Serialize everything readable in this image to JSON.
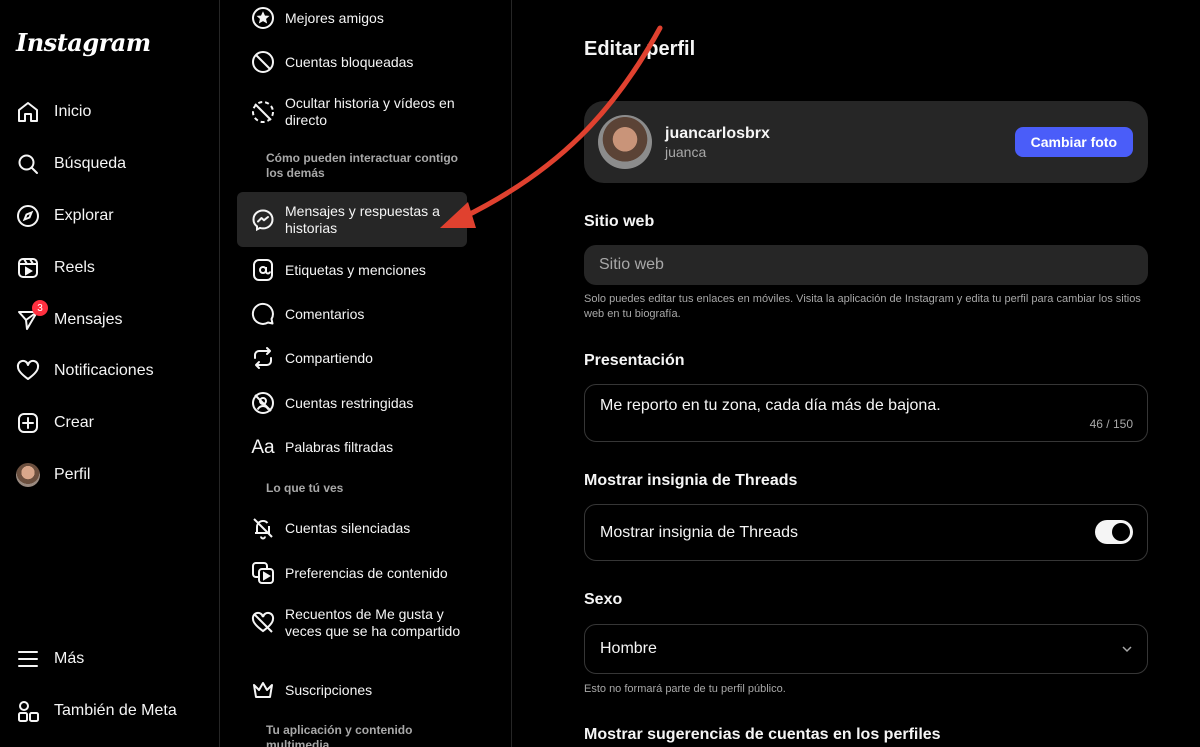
{
  "app": {
    "logo": "Instagram"
  },
  "nav": {
    "items": [
      {
        "label": "Inicio",
        "icon": "home-icon"
      },
      {
        "label": "Búsqueda",
        "icon": "search-icon"
      },
      {
        "label": "Explorar",
        "icon": "compass-icon"
      },
      {
        "label": "Reels",
        "icon": "reels-icon"
      },
      {
        "label": "Mensajes",
        "icon": "messenger-icon",
        "badge": "3"
      },
      {
        "label": "Notificaciones",
        "icon": "heart-icon"
      },
      {
        "label": "Crear",
        "icon": "plus-square-icon"
      },
      {
        "label": "Perfil",
        "icon": "avatar"
      }
    ],
    "more": "Más",
    "meta": "También de Meta"
  },
  "settings": {
    "items": [
      "Mejores amigos",
      "Cuentas bloqueadas",
      "Ocultar historia y vídeos en directo",
      "Mensajes y respuestas a historias",
      "Etiquetas y menciones",
      "Comentarios",
      "Compartiendo",
      "Cuentas restringidas",
      "Palabras filtradas",
      "Cuentas silenciadas",
      "Preferencias de contenido",
      "Recuentos de Me gusta y veces que se ha compartido",
      "Suscripciones"
    ],
    "headers": [
      "Cómo pueden interactuar contigo los demás",
      "Lo que tú ves",
      "Tu aplicación y contenido multimedia"
    ]
  },
  "main": {
    "title": "Editar perfil",
    "username": "juancarlosbrx",
    "fullname": "juanca",
    "change_photo": "Cambiar foto",
    "website_label": "Sitio web",
    "website_placeholder": "Sitio web",
    "website_help": "Solo puedes editar tus enlaces en móviles. Visita la aplicación de Instagram y edita tu perfil para cambiar los sitios web en tu biografía.",
    "bio_label": "Presentación",
    "bio_value": "Me reporto en tu zona, cada día más de bajona.",
    "bio_counter": "46 / 150",
    "threads_label": "Mostrar insignia de Threads",
    "threads_toggle_label": "Mostrar insignia de Threads",
    "threads_on": true,
    "gender_label": "Sexo",
    "gender_value": "Hombre",
    "gender_help": "Esto no formará parte de tu perfil público.",
    "suggestions_label": "Mostrar sugerencias de cuentas en los perfiles"
  },
  "colors": {
    "accent": "#4a5df9",
    "annotation": "#e0412f",
    "panel": "#262626"
  }
}
